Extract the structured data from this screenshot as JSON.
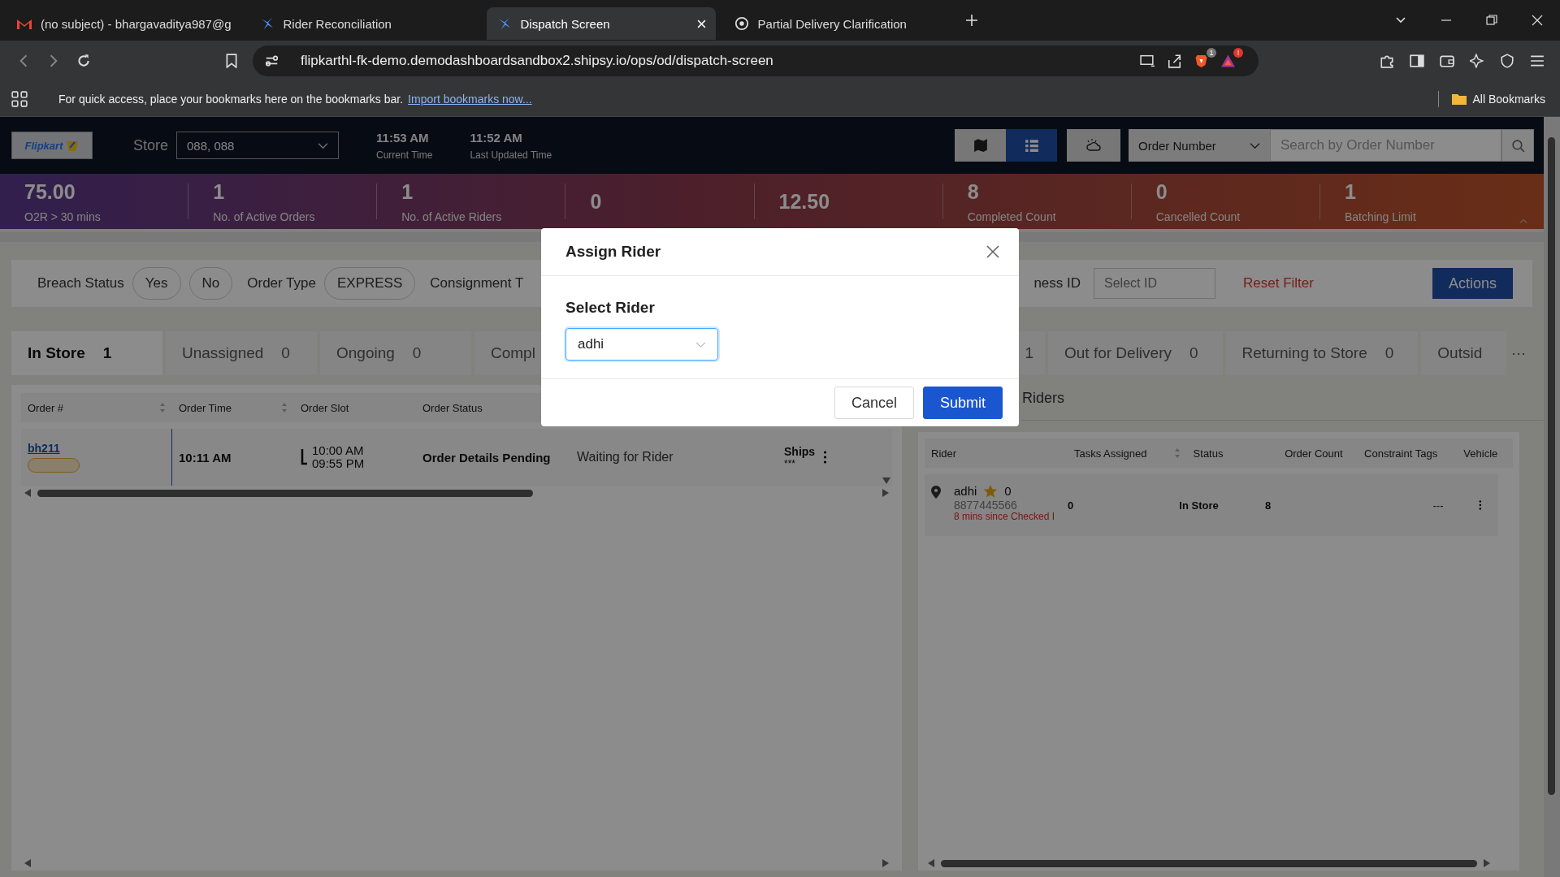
{
  "browser": {
    "tabs": [
      {
        "title": "(no subject) - bhargavaditya987@g",
        "kind": "mail",
        "selected": false
      },
      {
        "title": "Rider Reconciliation",
        "kind": "app",
        "selected": false
      },
      {
        "title": "Dispatch Screen",
        "kind": "app",
        "selected": true
      },
      {
        "title": "Partial Delivery Clarification",
        "kind": "web",
        "selected": false
      }
    ],
    "url": "flipkarthl-fk-demo.demodashboardsandbox2.shipsy.io/ops/od/dispatch-screen",
    "shield_badge": "1",
    "alert_badge": "!"
  },
  "bookmarks_bar": {
    "hint": "For quick access, place your bookmarks here on the bookmarks bar.",
    "link": "Import bookmarks now...",
    "folder": "All Bookmarks"
  },
  "header": {
    "logo": "Flipkart",
    "store_label": "Store",
    "store_value": "088, 088",
    "times": [
      {
        "time": "11:53 AM",
        "label": "Current Time"
      },
      {
        "time": "11:52 AM",
        "label": "Last Updated Time"
      }
    ],
    "views": [
      {
        "kind": "map",
        "selected": false
      },
      {
        "kind": "list",
        "selected": true
      }
    ],
    "search_by": "Order Number",
    "search_placeholder": "Search by Order Number"
  },
  "stats": [
    {
      "value": "75.00",
      "label": "O2R > 30 mins"
    },
    {
      "value": "1",
      "label": "No. of Active Orders"
    },
    {
      "value": "1",
      "label": "No. of Active Riders"
    },
    {
      "value": "0"
    },
    {
      "value": "12.50"
    },
    {
      "value": "8",
      "label": "Completed Count"
    },
    {
      "value": "0",
      "label": "Cancelled Count"
    },
    {
      "value": "1",
      "label": "Batching Limit"
    }
  ],
  "filters": {
    "left": [
      {
        "kind": "label",
        "text": "Breach Status"
      },
      {
        "kind": "chip",
        "text": "Yes"
      },
      {
        "kind": "chip",
        "text": "No"
      },
      {
        "kind": "label",
        "text": "Order Type"
      },
      {
        "kind": "chip",
        "text": "EXPRESS"
      },
      {
        "kind": "label",
        "text": "Consignment T"
      }
    ],
    "right_label": "ness ID",
    "id_placeholder": "Select ID",
    "reset": "Reset Filter",
    "actions": "Actions"
  },
  "order_tabs": [
    {
      "label": "In Store",
      "count": "1",
      "selected": true
    },
    {
      "label": "Unassigned",
      "count": "0",
      "selected": false
    },
    {
      "label": "Ongoing",
      "count": "0",
      "selected": false
    },
    {
      "label": "Compl",
      "selected": false
    }
  ],
  "rider_tabs": [
    {
      "count": "1",
      "selected": false
    },
    {
      "label": "Out for Delivery",
      "count": "0",
      "selected": false
    },
    {
      "label": "Returning to Store",
      "count": "0",
      "selected": false
    },
    {
      "label": "Outsid",
      "selected": false
    }
  ],
  "rider_tabs_more": "···",
  "orders": {
    "columns": [
      {
        "label": "Order #",
        "sortable": true
      },
      {
        "label": "Order Time",
        "sortable": true
      },
      {
        "label": "Order Slot"
      },
      {
        "label": "Order Status"
      }
    ],
    "rows": [
      {
        "order": "bh211",
        "order_time": "10:11 AM",
        "slot_start": "10:00 AM",
        "slot_end": "09:55 PM",
        "status": "Order Details Pending",
        "rider_status": "Waiting for Rider",
        "column_6": "Ships",
        "column_6_sub": "***"
      }
    ]
  },
  "riders": {
    "title": "Riders",
    "columns": [
      {
        "label": "Rider"
      },
      {
        "label": "Tasks Assigned",
        "sortable": true
      },
      {
        "label": "Status"
      },
      {
        "label": "Order Count"
      },
      {
        "label": "Constraint Tags"
      },
      {
        "label": "Vehicle"
      }
    ],
    "rows": [
      {
        "name": "adhi",
        "rating": "0",
        "phone": "8877445566",
        "checked_in": "8 mins since Checked I",
        "tasks": "0",
        "status": "In Store",
        "order_count": "8",
        "vehicle": "---"
      }
    ]
  },
  "modal": {
    "title": "Assign Rider",
    "field_label": "Select Rider",
    "value": "adhi",
    "buttons": [
      {
        "label": "Cancel",
        "kind": "secondary"
      },
      {
        "label": "Submit",
        "kind": "primary"
      }
    ]
  }
}
